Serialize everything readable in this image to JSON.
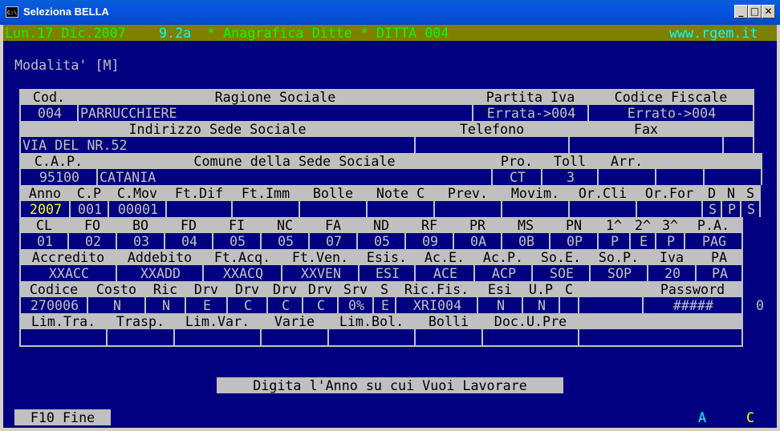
{
  "window": {
    "title": "Seleziona BELLA",
    "icon_text": "C:\\",
    "min_glyph": "_",
    "max_glyph": "□",
    "close_glyph": "✕"
  },
  "status": {
    "date": "Lun.17 Dic.2007",
    "version": "9.2a",
    "title": "* Anagrafica Ditte * DITTA 004",
    "website": "www.rgem.it"
  },
  "mode": "Modalita' [M]",
  "row1": {
    "headers": [
      "Cod.",
      "Ragione Sociale",
      "Partita Iva",
      "Codice Fiscale"
    ],
    "values": [
      "004",
      "PARRUCCHIERE",
      "Errata->004",
      "Errato->004"
    ]
  },
  "row2": {
    "headers": [
      "Indirizzo Sede Sociale",
      "Telefono",
      "Fax"
    ],
    "values": [
      "VIA DEL NR.52",
      "",
      ""
    ]
  },
  "row3": {
    "headers": [
      "C.A.P.",
      "Comune della Sede Sociale",
      "Pro.",
      "Toll",
      "Arr."
    ],
    "values": [
      "95100",
      "CATANIA",
      "CT",
      "3",
      ""
    ]
  },
  "row4": {
    "headers": [
      "Anno",
      "C.P",
      "C.Mov",
      "Ft.Dif",
      "Ft.Imm",
      "Bolle",
      "Note C",
      "Prev.",
      "Movim.",
      "Or.Cli",
      "Or.For",
      "D",
      "N",
      "S"
    ],
    "values": [
      "2007",
      "001",
      "00001",
      "",
      "",
      "",
      "",
      "",
      "",
      "",
      "",
      "S",
      "P",
      "S"
    ]
  },
  "row5": {
    "headers": [
      "CL",
      "FO",
      "BO",
      "FD",
      "FI",
      "NC",
      "FA",
      "ND",
      "RF",
      "PR",
      "MS",
      "PN",
      "1^",
      "2^",
      "3^",
      "P.A."
    ],
    "values": [
      "01",
      "02",
      "03",
      "04",
      "05",
      "05",
      "07",
      "05",
      "09",
      "0A",
      "0B",
      "0P",
      "P",
      "E",
      "P",
      "PAG"
    ]
  },
  "row6": {
    "headers": [
      "Accredito",
      "Addebito",
      "Ft.Acq.",
      "Ft.Ven.",
      "Esis.",
      "Ac.E.",
      "Ac.P.",
      "So.E.",
      "So.P.",
      "Iva",
      "PA"
    ],
    "values": [
      "XXACC",
      "XXADD",
      "XXACQ",
      "XXVEN",
      "ESI",
      "ACE",
      "ACP",
      "SOE",
      "SOP",
      "20",
      "PA"
    ]
  },
  "row7": {
    "headers": [
      "Codice",
      "Costo",
      "Ric",
      "Drv",
      "Drv",
      "Drv",
      "Drv",
      "Srv",
      "S",
      "Ric.Fis.",
      "Esi",
      "U.P",
      "C",
      "",
      "Password"
    ],
    "values": [
      "270006",
      "N",
      "N",
      "E",
      "C",
      "C",
      "C",
      "0%",
      "E",
      "XRI004",
      "N",
      "N",
      "",
      "",
      "#####"
    ],
    "side_value": "0"
  },
  "row8": {
    "headers": [
      "Lim.Tra.",
      "Trasp.",
      "Lim.Var.",
      "Varie",
      "Lim.Bol.",
      "Bolli",
      "Doc.U.Pre",
      ""
    ],
    "values": [
      "",
      "",
      "",
      "",
      "",
      "",
      "",
      ""
    ]
  },
  "prompt": "Digita l'Anno su cui Vuoi Lavorare",
  "footer": {
    "f10": "F10 Fine",
    "indicator_a": "A",
    "indicator_c": "C"
  },
  "colors": {
    "console_bg": "#000080",
    "text": "#c0c0c0",
    "status_bar": "#808000",
    "status_green": "#00ff00",
    "status_cyan": "#00ffff",
    "highlight_yellow": "#ffff00",
    "indicator_cyan": "#00ffff"
  }
}
